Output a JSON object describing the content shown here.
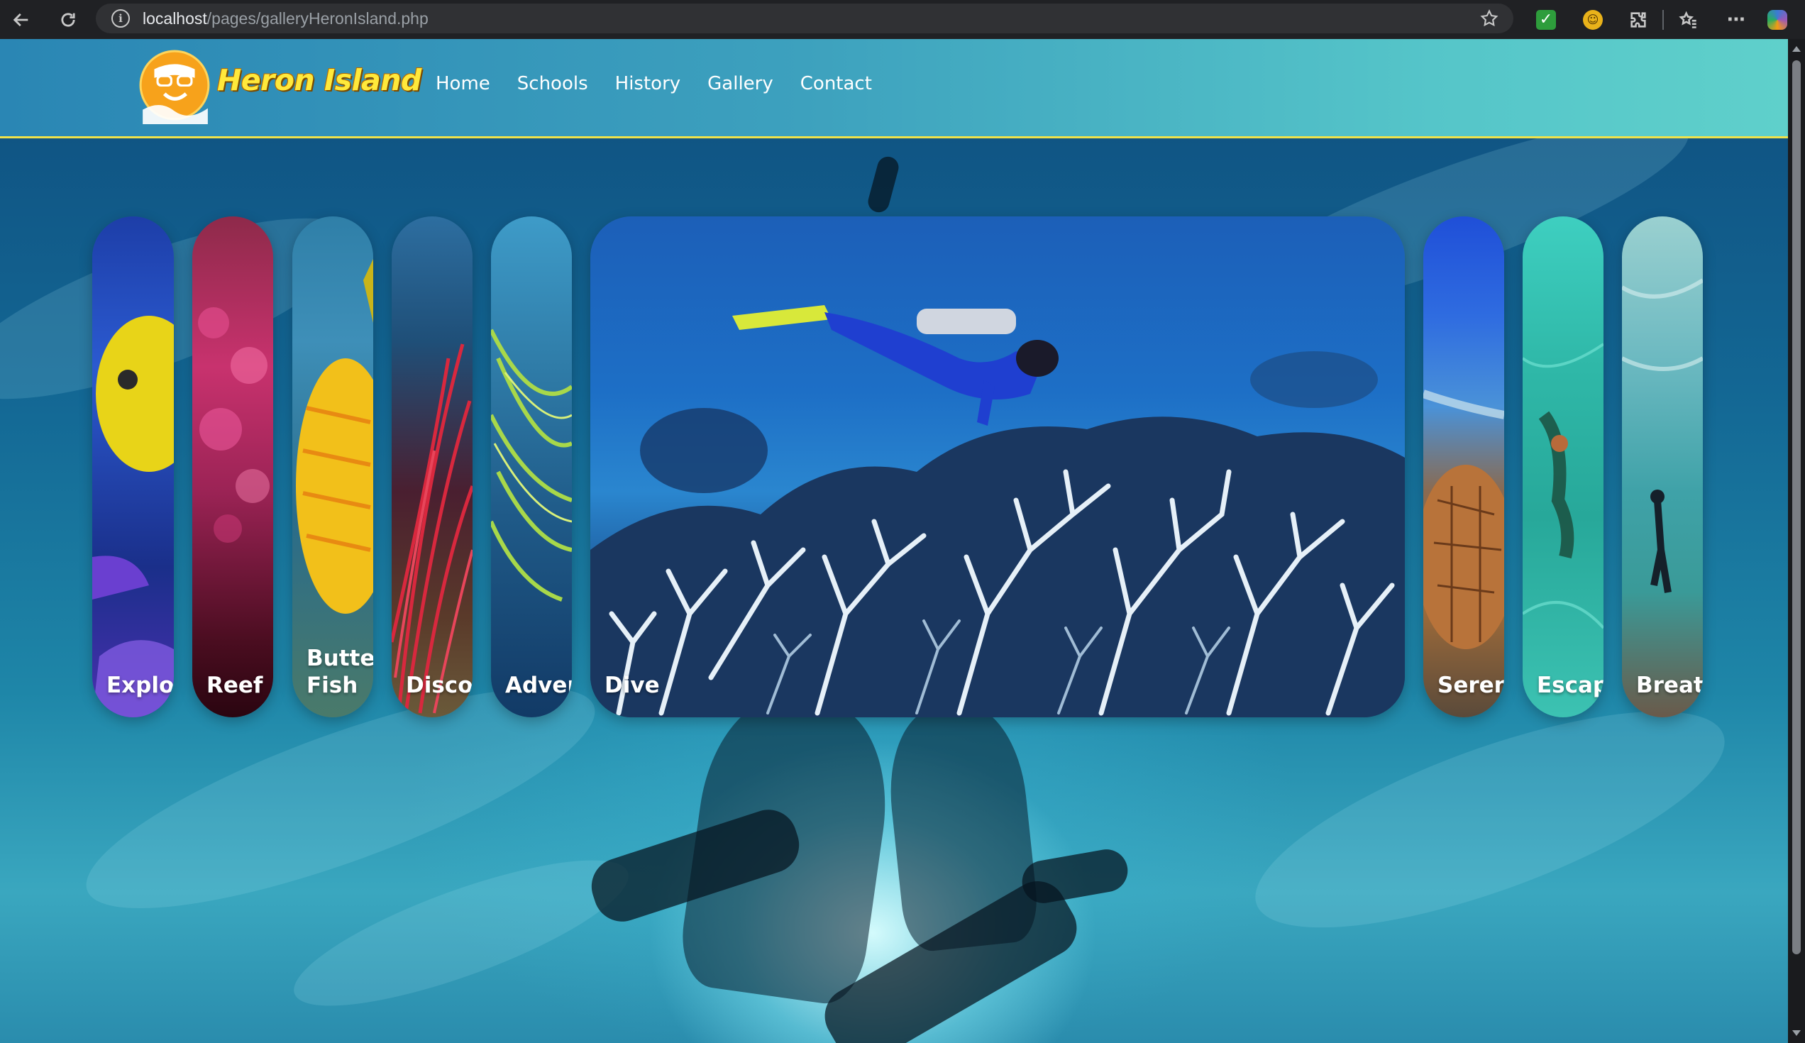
{
  "browser": {
    "url_host": "localhost",
    "url_path": "/pages/galleryHeronIsland.php",
    "icons": [
      "back-arrow-icon",
      "reload-icon",
      "info-icon",
      "star-icon",
      "shield-check-icon",
      "extension-face-icon",
      "puzzle-icon",
      "favorites-icon",
      "more-icon",
      "copilot-icon"
    ]
  },
  "site": {
    "logo_text": "Heron Island",
    "nav": [
      {
        "label": "Home"
      },
      {
        "label": "Schools"
      },
      {
        "label": "History"
      },
      {
        "label": "Gallery"
      },
      {
        "label": "Contact"
      }
    ],
    "accent_color": "#f0e34a",
    "logo_text_color": "#ffe93b"
  },
  "gallery": {
    "cards": [
      {
        "label": "Explore",
        "expanded": false
      },
      {
        "label": "Reef",
        "expanded": false
      },
      {
        "label": "Butter Fish",
        "expanded": false
      },
      {
        "label": "Discover",
        "expanded": false
      },
      {
        "label": "Adventure",
        "expanded": false
      },
      {
        "label": "Dive",
        "expanded": true
      },
      {
        "label": "Serenity",
        "expanded": false
      },
      {
        "label": "Escape",
        "expanded": false
      },
      {
        "label": "Breathe",
        "expanded": false
      }
    ]
  }
}
